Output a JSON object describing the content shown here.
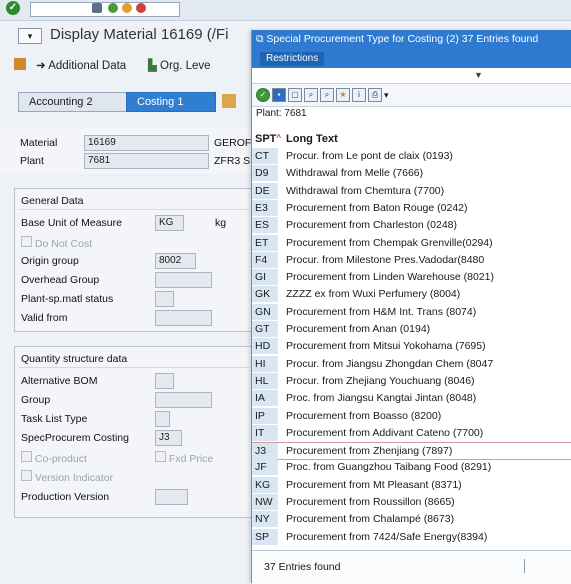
{
  "window": {
    "title": "Display Material 16169 (/Fi",
    "toolbar_ok": "✓"
  },
  "app_toolbar": {
    "additional_data": "Additional Data",
    "org_levels": "Org. Leve"
  },
  "tabs": {
    "accounting2": "Accounting 2",
    "costing1": "Costing 1"
  },
  "header_fields": {
    "material_label": "Material",
    "material_value": "16169",
    "material_desc": "GEROF",
    "plant_label": "Plant",
    "plant_value": "7681",
    "plant_desc": "ZFR3 S"
  },
  "general_data": {
    "title": "General Data",
    "base_uom_label": "Base Unit of Measure",
    "base_uom_value": "KG",
    "base_uom_text": "kg",
    "do_not_cost": "Do Not Cost",
    "origin_group_label": "Origin group",
    "origin_group_value": "8002",
    "overhead_group_label": "Overhead Group",
    "plant_status_label": "Plant-sp.matl status",
    "valid_from_label": "Valid from"
  },
  "qty_structure": {
    "title": "Quantity structure data",
    "alt_bom_label": "Alternative BOM",
    "group_label": "Group",
    "task_list_label": "Task List Type",
    "spec_proc_label": "SpecProcurem Costing",
    "spec_proc_value": "J3",
    "coproduct": "Co-product",
    "fxd_price": "Fxd Price",
    "version_indicator": "Version Indicator",
    "prod_version_label": "Production Version"
  },
  "popup": {
    "title": "Special Procurement Type for Costing (2)   37 Entries found",
    "restrictions_tab": "Restrictions",
    "plant_line": "Plant: 7681",
    "col_spt": "SPT",
    "col_text": "Long Text",
    "status": "37 Entries found",
    "rows": [
      {
        "code": "CT",
        "text": "Procur. from Le pont de claix (0193)"
      },
      {
        "code": "D9",
        "text": "Withdrawal from Melle (7666)"
      },
      {
        "code": "DE",
        "text": "Withdrawal from Chemtura (7700)"
      },
      {
        "code": "E3",
        "text": "Procurement from Baton Rouge (0242)"
      },
      {
        "code": "ES",
        "text": "Procurement from Charleston (0248)"
      },
      {
        "code": "ET",
        "text": "Procurement from Chempak Grenville(0294)"
      },
      {
        "code": "F4",
        "text": "Procur. from Milestone Pres.Vadodar(8480"
      },
      {
        "code": "GI",
        "text": "Procurement from Linden Warehouse (8021)"
      },
      {
        "code": "GK",
        "text": "ZZZZ ex from Wuxi Perfumery (8004)"
      },
      {
        "code": "GN",
        "text": "Procurement from H&M Int. Trans (8074)"
      },
      {
        "code": "GT",
        "text": "Procurement from Anan (0194)"
      },
      {
        "code": "HD",
        "text": "Procurement from Mitsui Yokohama (7695)"
      },
      {
        "code": "HI",
        "text": "Procur. from Jiangsu Zhongdan Chem (8047"
      },
      {
        "code": "HL",
        "text": "Procur. from Zhejiang Youchuang (8046)"
      },
      {
        "code": "IA",
        "text": "Proc. from Jiangsu Kangtai Jintan (8048)"
      },
      {
        "code": "IP",
        "text": "Procurement from Boasso (8200)"
      },
      {
        "code": "IT",
        "text": "Procurement from Addivant Cateno (7700)"
      },
      {
        "code": "J3",
        "text": "Procurement from Zhenjiang (7897)"
      },
      {
        "code": "JF",
        "text": "Proc. from Guangzhou Taibang Food (8291)"
      },
      {
        "code": "KG",
        "text": "Procurement from Mt Pleasant (8371)"
      },
      {
        "code": "NW",
        "text": "Procurement from Roussillon (8665)"
      },
      {
        "code": "NY",
        "text": "Procurement from Chalampé (8673)"
      },
      {
        "code": "SP",
        "text": "Procurement from 7424/Safe Energy(8394)"
      }
    ]
  },
  "colors": {
    "accent": "#2d7ad0",
    "row_code_bg": "#d8e6f4",
    "selected_border": "#d49a9a"
  }
}
